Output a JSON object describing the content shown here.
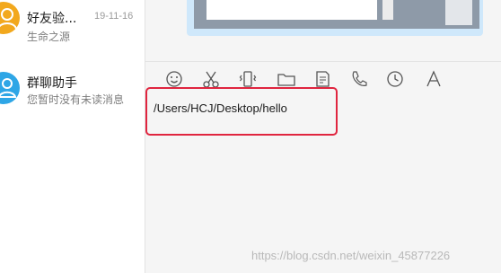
{
  "conversations": [
    {
      "name": "好友验...",
      "time": "19-11-16",
      "preview": "生命之源",
      "avatar_color": "#f2a81d"
    },
    {
      "name": "群聊助手",
      "time": "",
      "preview": "您暂时没有未读消息",
      "avatar_color": "#2ea6e6"
    }
  ],
  "toolbar": {
    "icons": [
      "emoji-icon",
      "scissors-icon",
      "shake-icon",
      "folder-icon",
      "file-send-icon",
      "phone-icon",
      "clock-icon",
      "font-icon"
    ]
  },
  "input": {
    "text": "/Users/HCJ/Desktop/hello"
  },
  "watermark": "https://blog.csdn.net/weixin_45877226",
  "colors": {
    "highlight": "#e0253f",
    "bubble": "#cfe8fb",
    "background": "#f5f5f5"
  }
}
